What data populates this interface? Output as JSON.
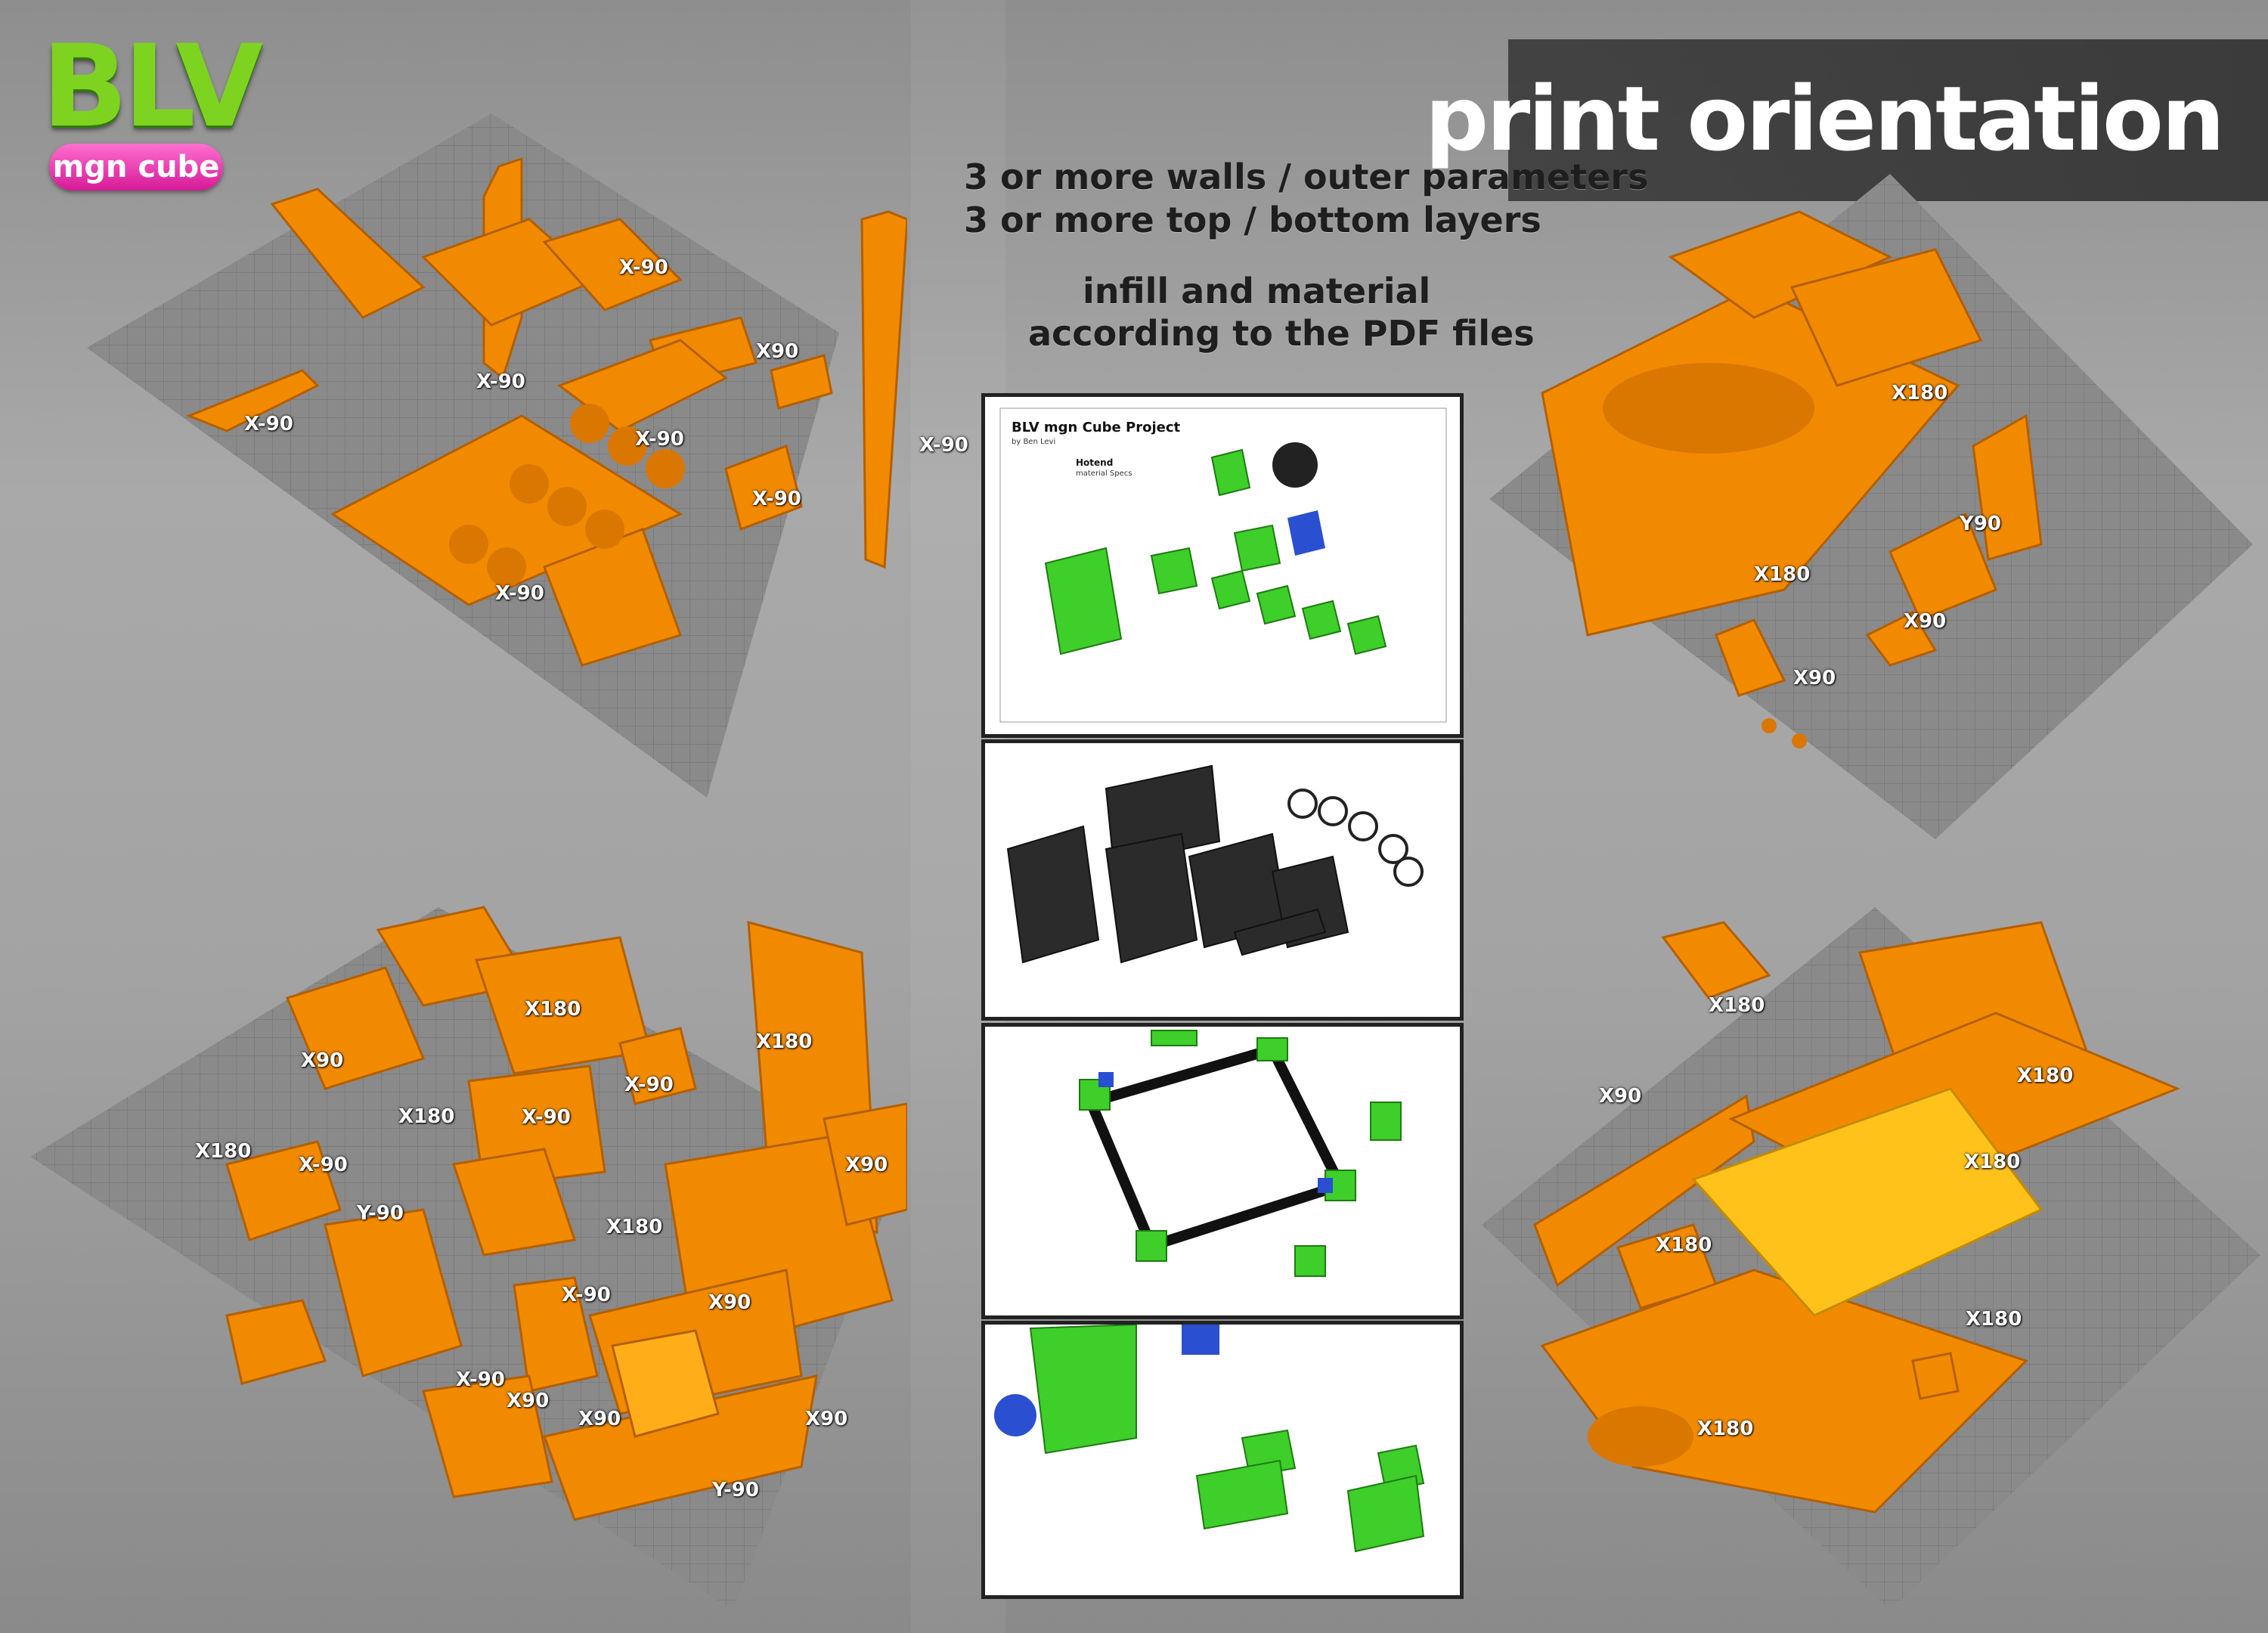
{
  "logo": {
    "brand": "BLV",
    "product": "mgn cube"
  },
  "title": "print orientation",
  "notes": {
    "line1": "3 or more walls / outer parameters",
    "line2": "3 or more top / bottom layers",
    "line3": "infill and material",
    "line4": "according to the PDF files"
  },
  "pdf": {
    "project_title": "BLV mgn Cube Project",
    "author": "by Ben Levi",
    "section": "Hotend",
    "section_sub": "material Specs"
  },
  "plates": {
    "top_left": [
      "X-90",
      "X-90",
      "X90",
      "X-90",
      "X-90",
      "X-90",
      "X-90",
      "X-90"
    ],
    "top_right": [
      "X180",
      "Y90",
      "X180",
      "X90",
      "X90"
    ],
    "bottom_left": [
      "X180",
      "X180",
      "X90",
      "X-90",
      "X180",
      "X-90",
      "X180",
      "X-90",
      "X90",
      "Y-90",
      "X180",
      "X-90",
      "X90",
      "X-90",
      "X90",
      "X90",
      "X90",
      "Y-90"
    ],
    "bottom_right": [
      "X180",
      "X180",
      "X90",
      "X180",
      "X180",
      "X180",
      "X180"
    ]
  },
  "colors": {
    "part_orange": "#f28a00",
    "part_yellow": "#ffc21a",
    "bed_grey": "#808080",
    "pdf_green": "#3ecf2a",
    "pdf_blue": "#2a4fd1",
    "logo_green": "#7ed321",
    "logo_pink": "#e62ea6"
  }
}
